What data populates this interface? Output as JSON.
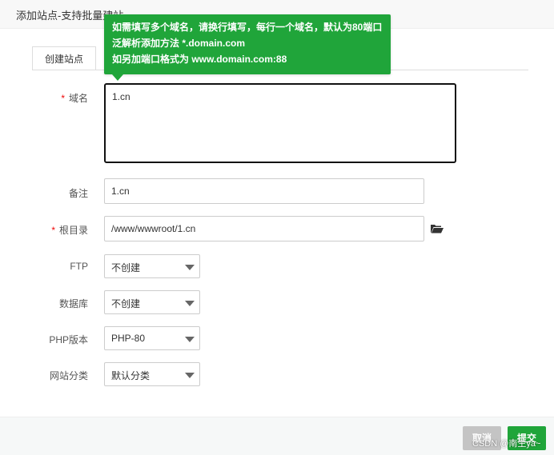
{
  "dialog": {
    "title": "添加站点-支持批量建站"
  },
  "tabs": [
    {
      "label": "创建站点"
    }
  ],
  "tooltip": {
    "lines": [
      "如需填写多个域名，请换行填写，每行一个域名，默认为80端口",
      "泛解析添加方法 *.domain.com",
      "如另加端口格式为 www.domain.com:88"
    ]
  },
  "form": {
    "domain": {
      "required_mark": "*",
      "label": "域名",
      "value": "1.cn"
    },
    "remark": {
      "label": "备注",
      "value": "1.cn"
    },
    "root": {
      "required_mark": "*",
      "label": "根目录",
      "value": "/www/wwwroot/1.cn"
    },
    "ftp": {
      "label": "FTP",
      "value": "不创建"
    },
    "database": {
      "label": "数据库",
      "value": "不创建"
    },
    "php": {
      "label": "PHP版本",
      "value": "PHP-80"
    },
    "category": {
      "label": "网站分类",
      "value": "默认分类"
    }
  },
  "footer": {
    "cancel_label": "取消",
    "submit_label": "提交"
  },
  "watermark": {
    "text": "CSDN @南生ya~"
  },
  "colors": {
    "accent": "#20a53a",
    "required": "#ef0808",
    "cancel": "#c4c4c4"
  }
}
